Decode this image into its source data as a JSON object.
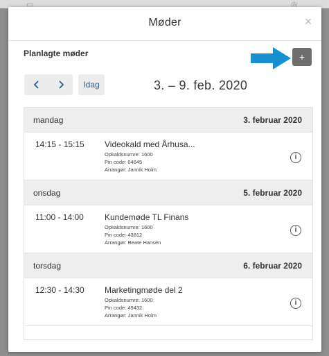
{
  "dialog": {
    "title": "Møder",
    "close_label": "×"
  },
  "toolbar": {
    "section_title": "Planlagte møder",
    "add_label": "+",
    "today_label": "Idag",
    "date_range": "3. – 9. feb. 2020"
  },
  "colors": {
    "arrow": "#1a8fd0",
    "add_button": "#6e6e6e",
    "day_header_bg": "#eeeeee"
  },
  "days": [
    {
      "weekday": "mandag",
      "date": "3. februar 2020",
      "meetings": [
        {
          "time": "14:15 - 15:15",
          "title": "Videokald med Århusa...",
          "dial": "Opkaldsnumre: 1600",
          "pin": "Pin code: 04645",
          "organizer": "Arrangør: Jannik Holm"
        }
      ]
    },
    {
      "weekday": "onsdag",
      "date": "5. februar 2020",
      "meetings": [
        {
          "time": "11:00 - 14:00",
          "title": "Kundemøde TL Finans",
          "dial": "Opkaldsnumre: 1600",
          "pin": "Pin code: 43812",
          "organizer": "Arrangør: Beate Hansen"
        }
      ]
    },
    {
      "weekday": "torsdag",
      "date": "6. februar 2020",
      "meetings": [
        {
          "time": "12:30 - 14:30",
          "title": "Marketingmøde del 2",
          "dial": "Opkaldsnumre: 1600",
          "pin": "Pin code: 49432",
          "organizer": "Arrangør: Jannik Holm"
        }
      ]
    }
  ],
  "icons": {
    "prev": "chevron-left-icon",
    "next": "chevron-right-icon",
    "info": "info-icon",
    "pointer": "arrow-right-icon"
  }
}
